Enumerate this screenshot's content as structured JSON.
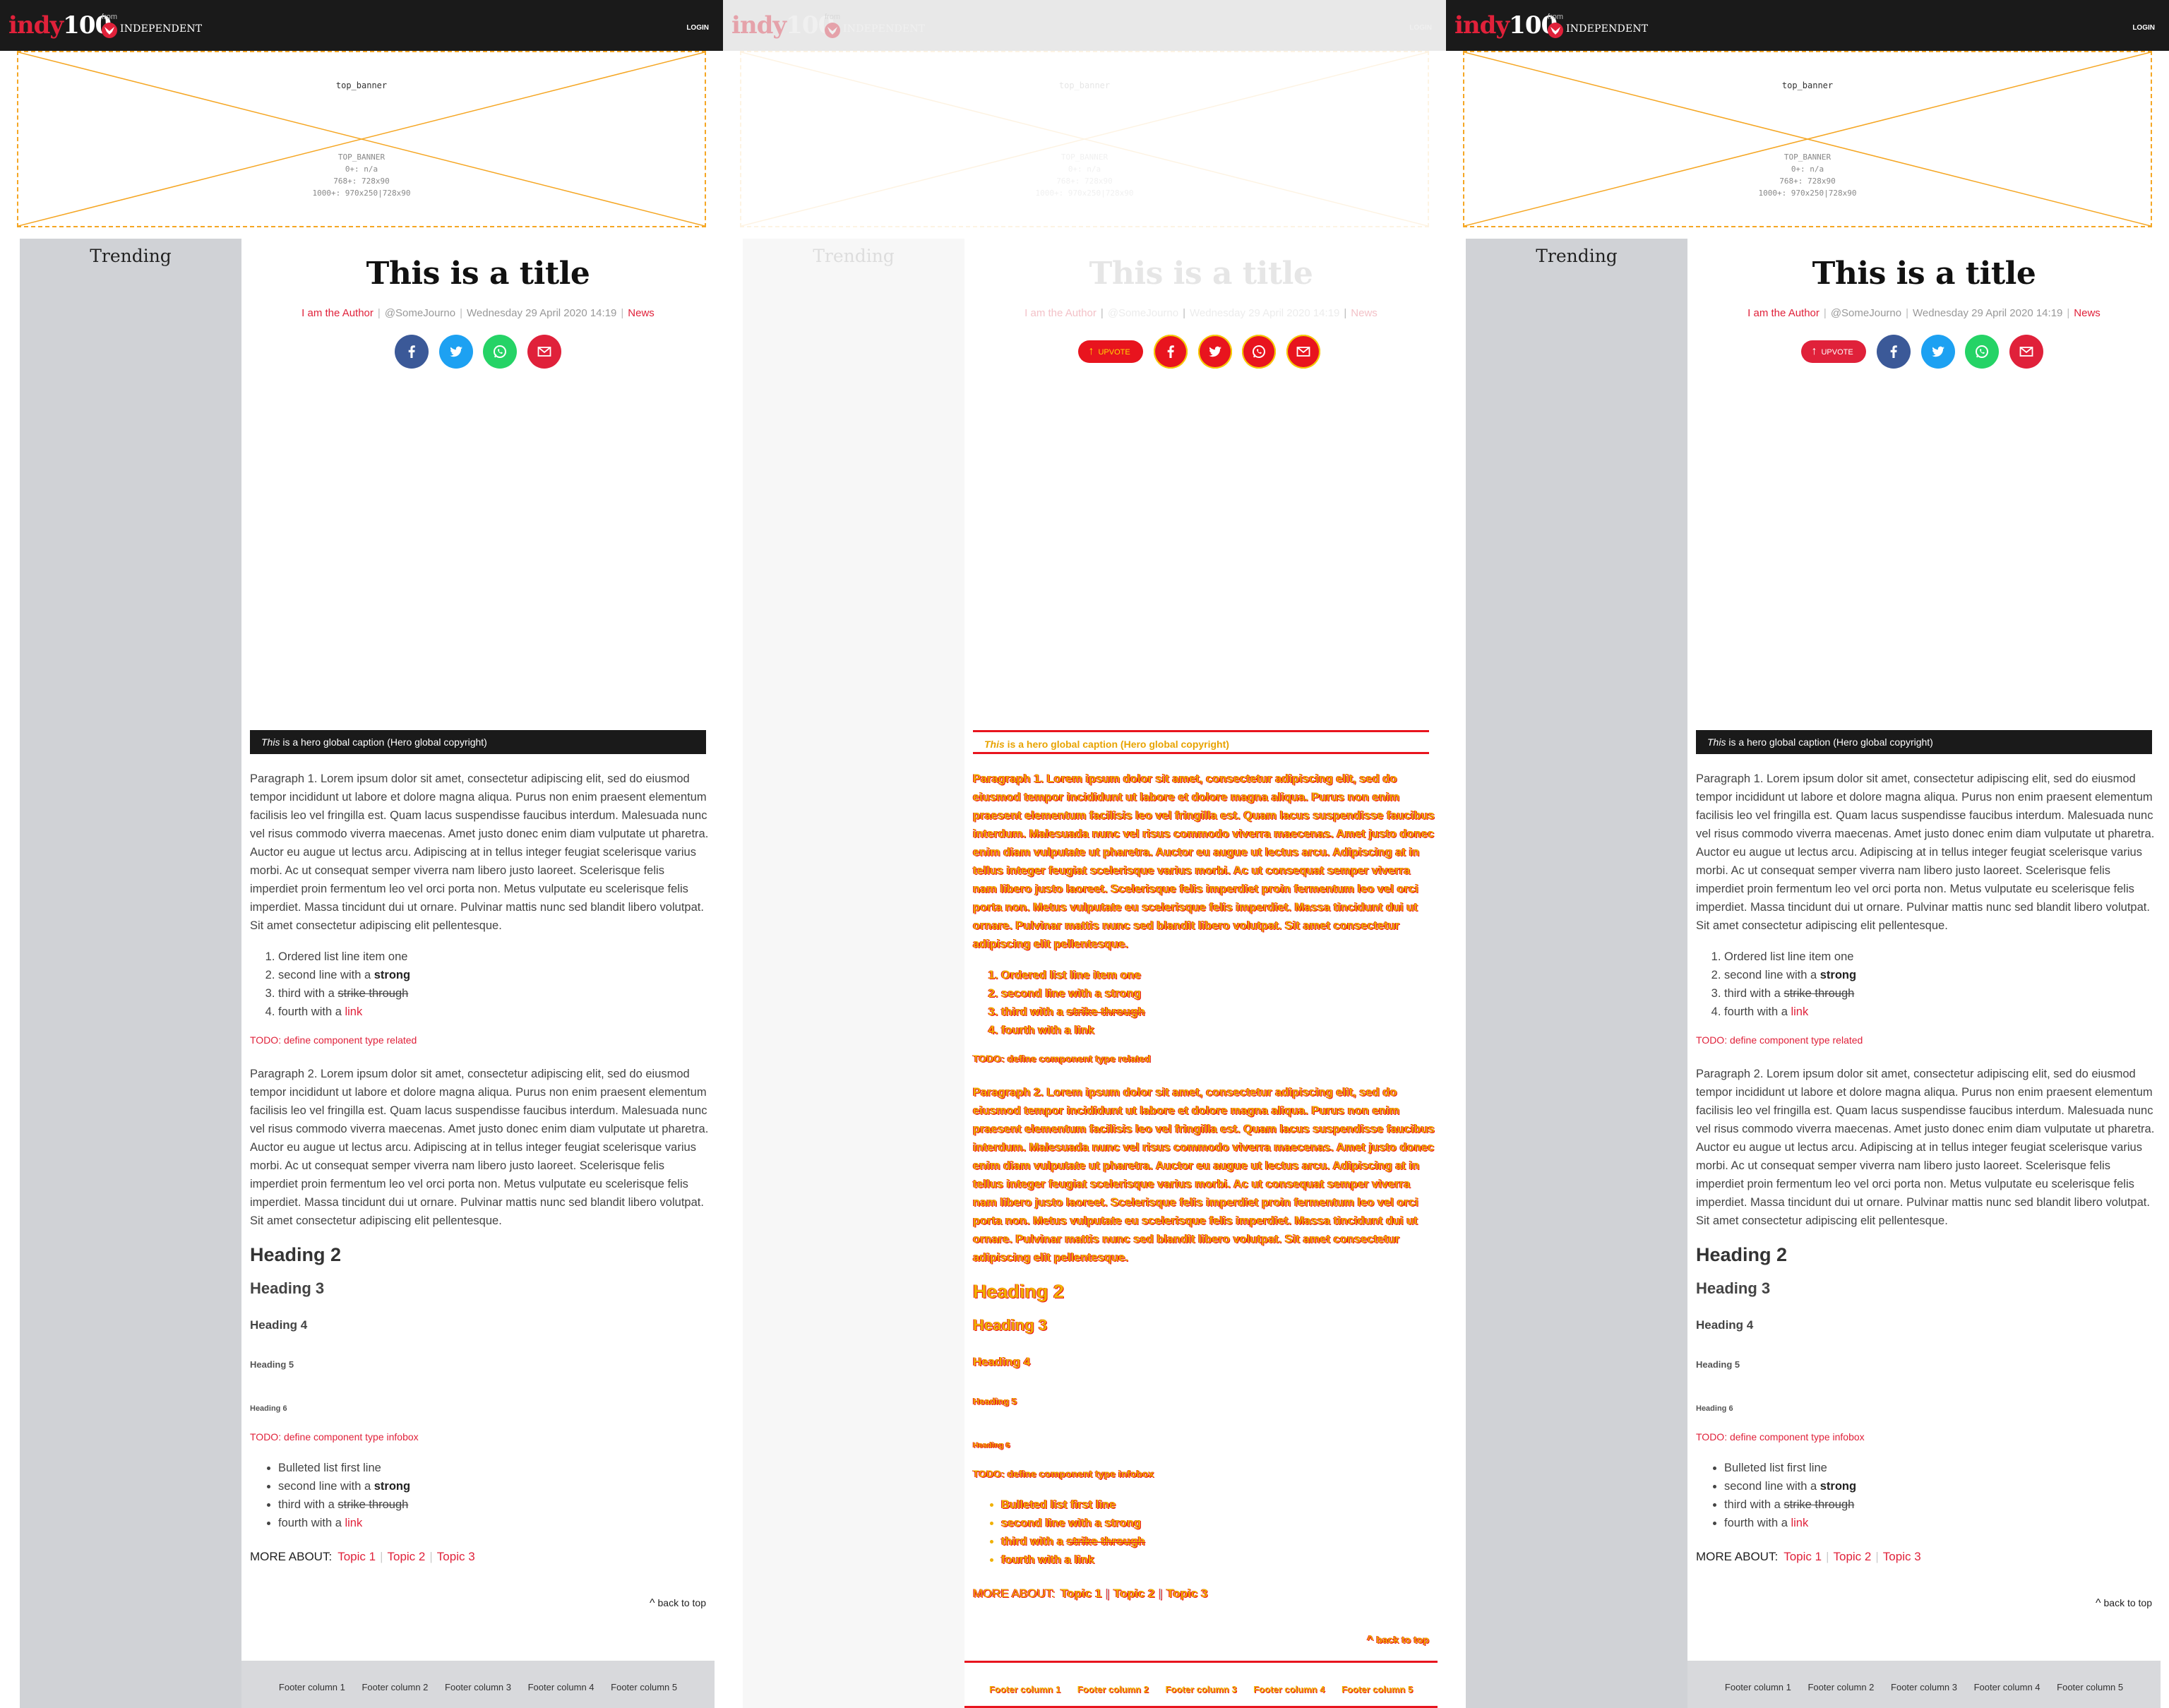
{
  "header": {
    "logo_indy": "indy",
    "logo_num": "100",
    "from": "from",
    "independent": "INDEPENDENT",
    "login": "LOGIN"
  },
  "banner": {
    "name": "top_banner",
    "spec": [
      "TOP_BANNER",
      "0+: n/a",
      "768+: 728x90",
      "1000+: 970x250|728x90"
    ]
  },
  "sidebar": {
    "title": "Trending"
  },
  "article": {
    "title": "This is a title",
    "author": "I am the Author",
    "handle": "@SomeJourno",
    "date": "Wednesday 29 April 2020 14:19",
    "section": "News",
    "upvote": "UPVOTE",
    "caption_em": "This",
    "caption_rest": " is a hero global caption (Hero global copyright)",
    "p1": "Paragraph 1. Lorem ipsum dolor sit amet, consectetur adipiscing elit, sed do eiusmod tempor incididunt ut labore et dolore magna aliqua. Purus non enim praesent elementum facilisis leo vel fringilla est. Quam lacus suspendisse faucibus interdum. Malesuada nunc vel risus commodo viverra maecenas. Amet justo donec enim diam vulputate ut pharetra. Auctor eu augue ut lectus arcu. Adipiscing at in tellus integer feugiat scelerisque varius morbi. Ac ut consequat semper viverra nam libero justo laoreet. Scelerisque felis imperdiet proin fermentum leo vel orci porta non. Metus vulputate eu scelerisque felis imperdiet. Massa tincidunt dui ut ornare. Pulvinar mattis nunc sed blandit libero volutpat. Sit amet consectetur adipiscing elit pellentesque.",
    "ol": {
      "i1": "Ordered list line item one",
      "i2_pre": "second line with a ",
      "i2_strong": "strong",
      "i3_pre": "third with a ",
      "i3_strike": "strike through",
      "i4_pre": "fourth with a ",
      "i4_link": "link"
    },
    "todo_related": "TODO: define component type related",
    "p2": "Paragraph 2. Lorem ipsum dolor sit amet, consectetur adipiscing elit, sed do eiusmod tempor incididunt ut labore et dolore magna aliqua. Purus non enim praesent elementum facilisis leo vel fringilla est. Quam lacus suspendisse faucibus interdum. Malesuada nunc vel risus commodo viverra maecenas. Amet justo donec enim diam vulputate ut pharetra. Auctor eu augue ut lectus arcu. Adipiscing at in tellus integer feugiat scelerisque varius morbi. Ac ut consequat semper viverra nam libero justo laoreet. Scelerisque felis imperdiet proin fermentum leo vel orci porta non. Metus vulputate eu scelerisque felis imperdiet. Massa tincidunt dui ut ornare. Pulvinar mattis nunc sed blandit libero volutpat. Sit amet consectetur adipiscing elit pellentesque.",
    "h2": "Heading 2",
    "h3": "Heading 3",
    "h4": "Heading 4",
    "h5": "Heading 5",
    "h6": "Heading 6",
    "todo_infobox": "TODO: define component type infobox",
    "ul": {
      "i1": "Bulleted list first line",
      "i2_pre": "second line with a ",
      "i2_strong": "strong",
      "i3_pre": "third with a ",
      "i3_strike": "strike through",
      "i4_pre": "fourth with a ",
      "i4_link": "link"
    },
    "more_about": "MORE ABOUT:",
    "topics": [
      "Topic 1",
      "Topic 2",
      "Topic 3"
    ],
    "back_to_top": "back to top"
  },
  "footer": {
    "columns": [
      "Footer column 1",
      "Footer column 2",
      "Footer column 3",
      "Footer column 4",
      "Footer column 5"
    ]
  },
  "colors": {
    "brand_red": "#e0213a",
    "header_bg": "#1a1a1a",
    "sidebar_bg": "#d0d2d6",
    "banner_dash": "#f5a623",
    "overlay_yellow": "#f0b000",
    "overlay_red": "#e8141e"
  }
}
